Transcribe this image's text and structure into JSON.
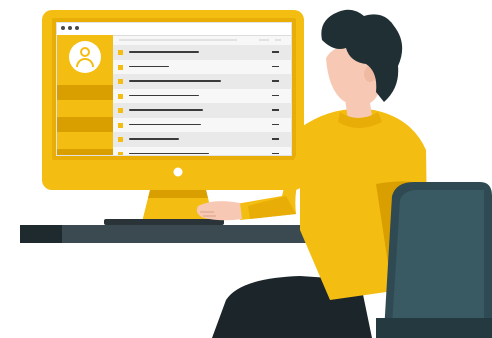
{
  "illustration": {
    "subject": "person-at-desktop-computer",
    "colors": {
      "accent": "#f4bd11",
      "accent_dark": "#d99f00",
      "hair": "#1f2f33",
      "skin": "#f7c9b4",
      "chair": "#2f4a52",
      "desk": "#3a4a50",
      "pants": "#1c2529"
    }
  },
  "screen": {
    "window_dots": 3,
    "sidebar": {
      "icon": "user-avatar-icon",
      "highlighted_sections": 3
    },
    "rows": [
      {
        "bullet": true,
        "alt": true
      },
      {
        "bullet": true,
        "alt": false
      },
      {
        "bullet": true,
        "alt": true
      },
      {
        "bullet": true,
        "alt": false
      },
      {
        "bullet": true,
        "alt": true
      },
      {
        "bullet": true,
        "alt": false
      },
      {
        "bullet": true,
        "alt": true
      },
      {
        "bullet": true,
        "alt": false
      }
    ]
  }
}
